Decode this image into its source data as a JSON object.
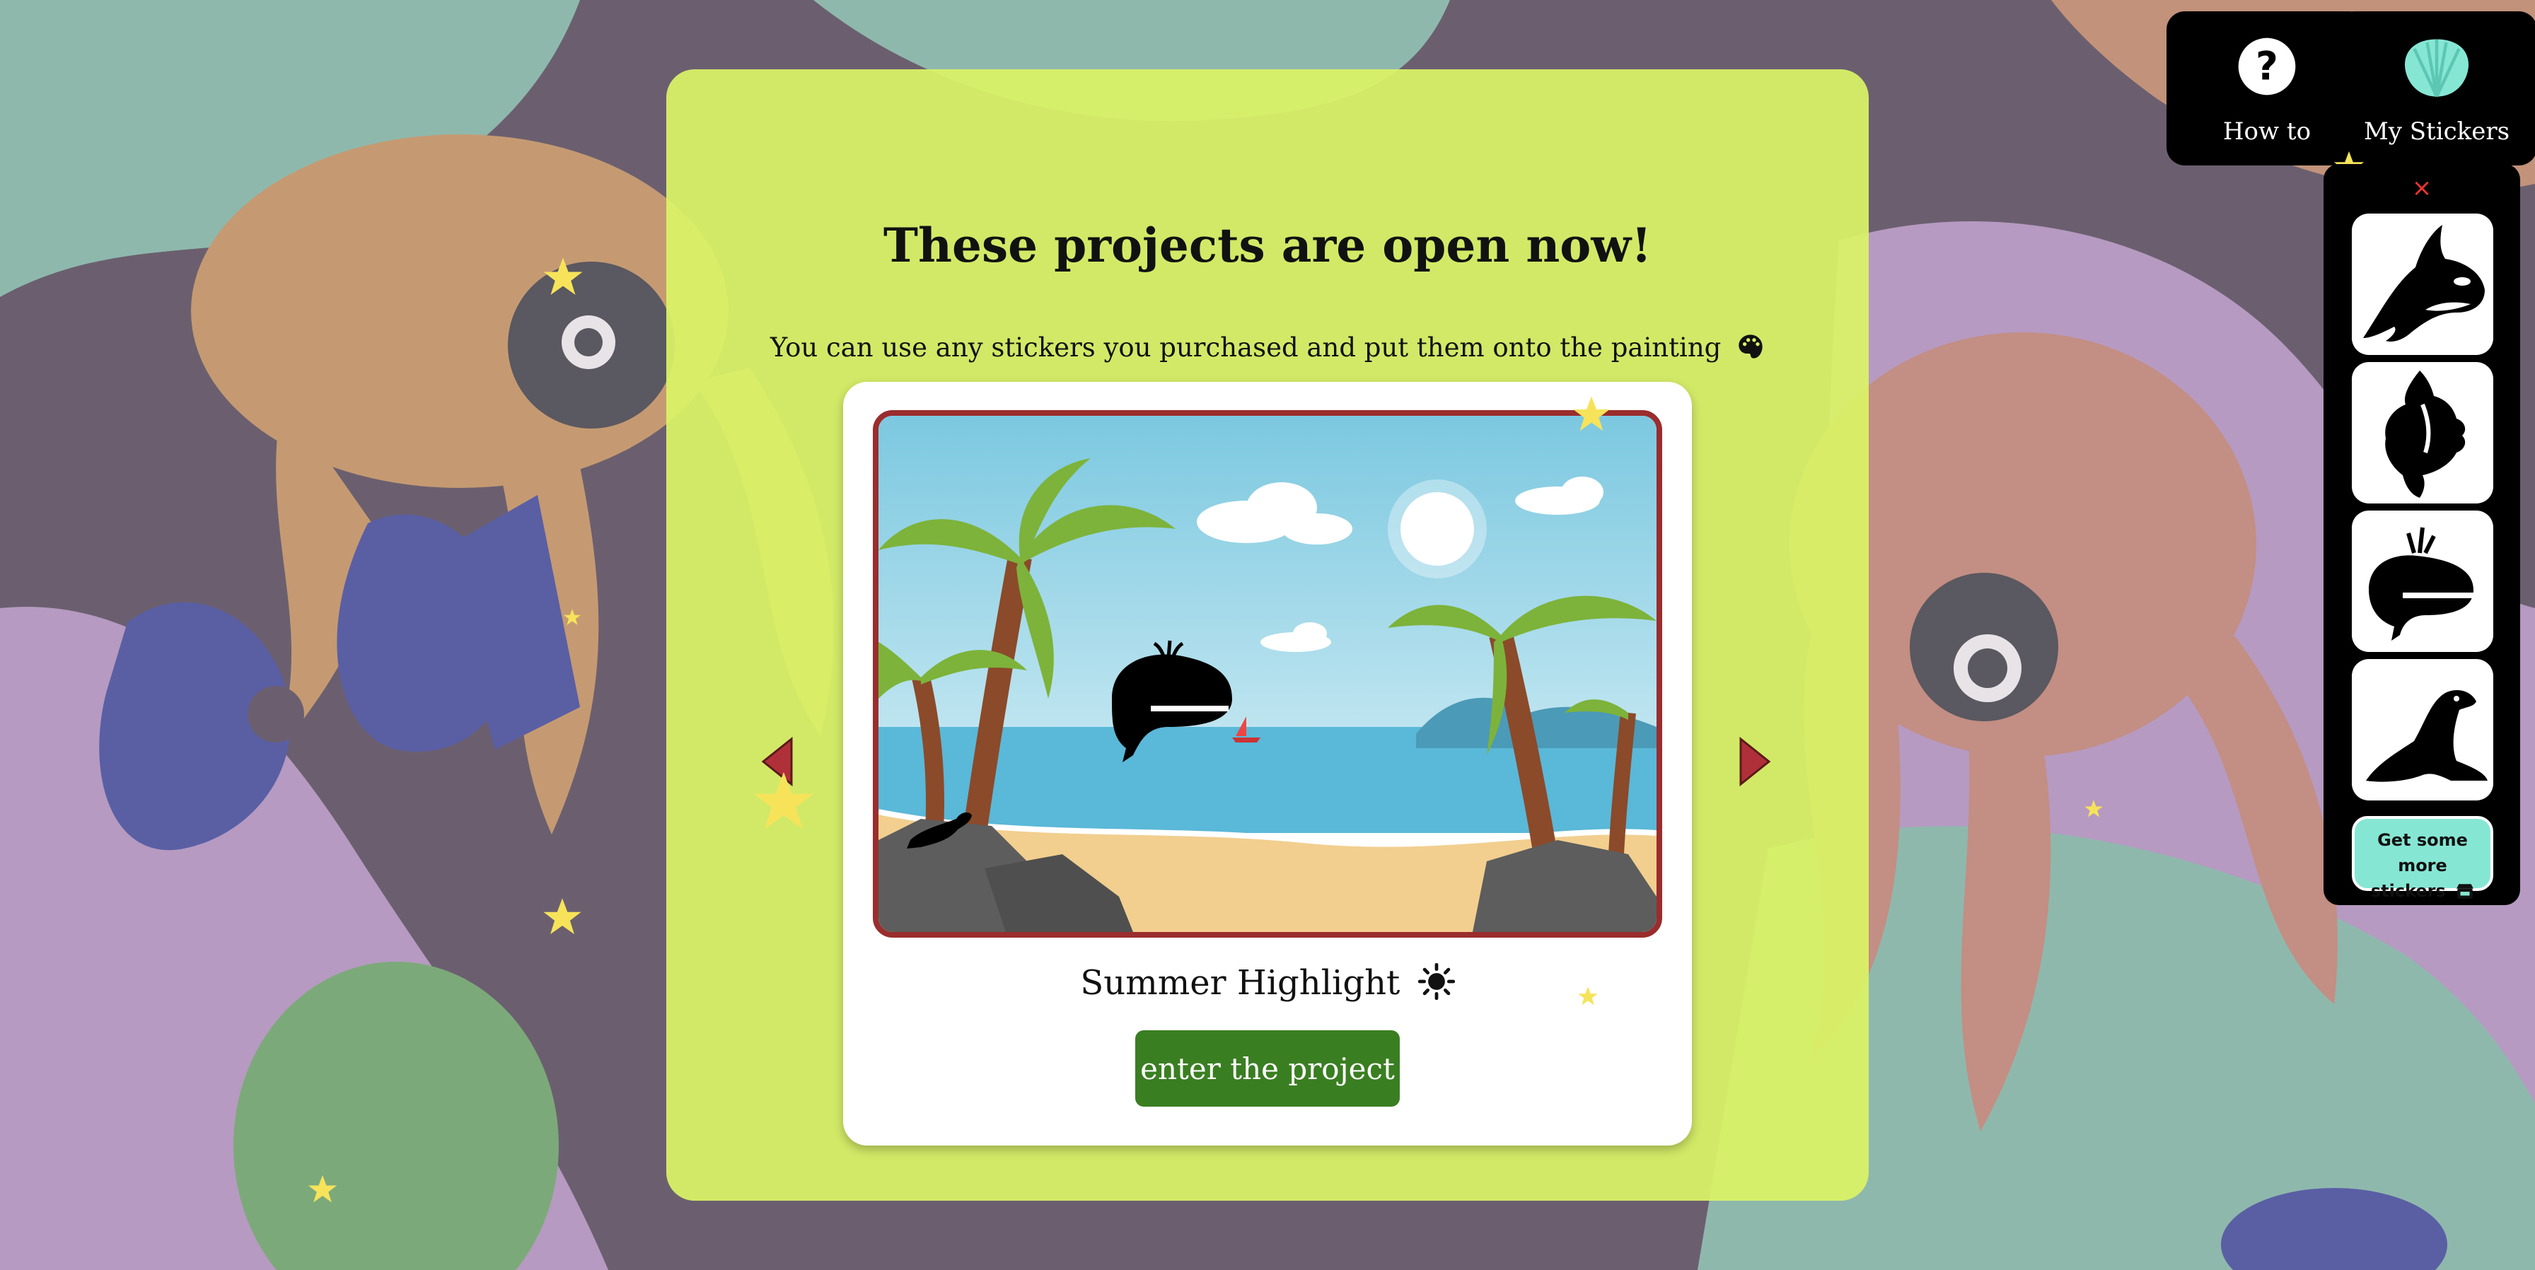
{
  "panel": {
    "headline": "These projects are open now!",
    "subline": "You can use any stickers you purchased and put them onto the painting"
  },
  "project": {
    "title": "Summer Highlight",
    "enter_label": "enter the project"
  },
  "top_buttons": {
    "howto_label": "How to",
    "stickers_label": "My Stickers"
  },
  "sticker_panel": {
    "close_glyph": "×",
    "stickers": [
      "orca-icon",
      "shell-icon",
      "whale-icon",
      "seal-icon"
    ],
    "more_line1": "Get some more",
    "more_line2": "stickers"
  },
  "colors": {
    "panel": "#daf366",
    "enter_button": "#3a7e22",
    "painting_border": "#9a2d2d",
    "more_button": "#86e6d4"
  }
}
